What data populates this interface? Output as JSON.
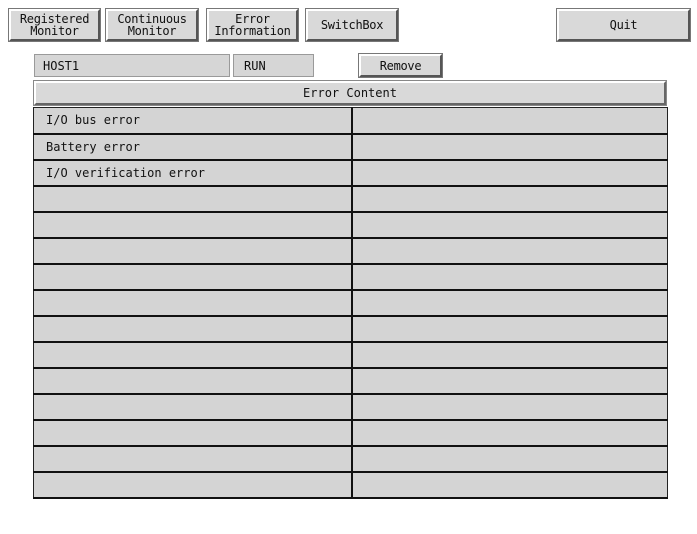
{
  "toolbar": {
    "registered_monitor": [
      "Registered",
      "Monitor"
    ],
    "continuous_monitor": [
      "Continuous",
      "Monitor"
    ],
    "error_information": [
      "Error",
      "Information"
    ],
    "switchbox": "SwitchBox",
    "quit": "Quit"
  },
  "status": {
    "host": "HOST1",
    "state": "RUN",
    "remove_label": "Remove"
  },
  "error_panel": {
    "header": "Error Content",
    "rows": [
      [
        "I/O bus error",
        ""
      ],
      [
        "Battery error",
        ""
      ],
      [
        "I/O verification error",
        ""
      ],
      [
        "",
        ""
      ],
      [
        "",
        ""
      ],
      [
        "",
        ""
      ],
      [
        "",
        ""
      ],
      [
        "",
        ""
      ],
      [
        "",
        ""
      ],
      [
        "",
        ""
      ],
      [
        "",
        ""
      ],
      [
        "",
        ""
      ],
      [
        "",
        ""
      ],
      [
        "",
        ""
      ],
      [
        "",
        ""
      ]
    ]
  },
  "colors": {
    "button_face": "#d9d9d9",
    "cell_fill": "#d4d4d4",
    "grid_line": "#111111",
    "background": "#ffffff"
  }
}
